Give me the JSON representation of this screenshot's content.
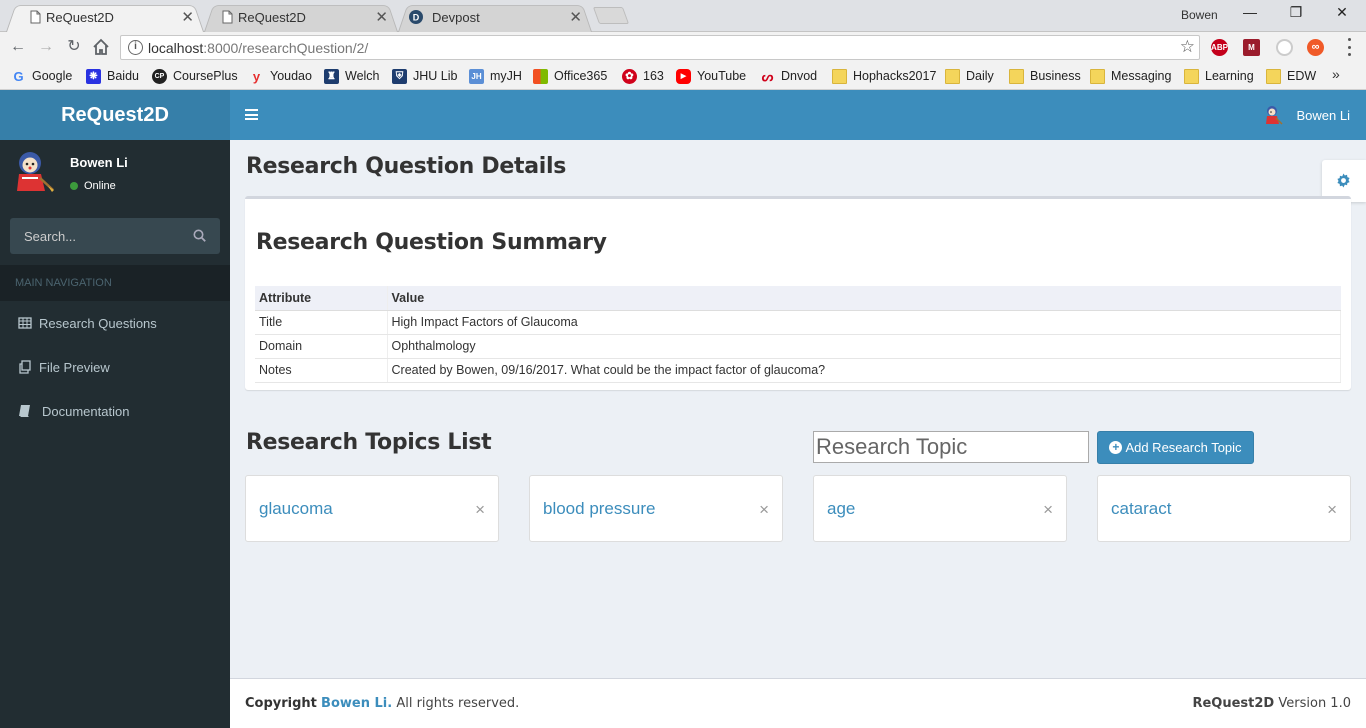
{
  "browser": {
    "tabs": [
      {
        "title": "ReQuest2D",
        "active": true
      },
      {
        "title": "ReQuest2D",
        "active": false
      },
      {
        "title": "Devpost",
        "active": false
      }
    ],
    "profile_name": "Bowen",
    "url_host": "localhost",
    "url_path": ":8000/researchQuestion/2/",
    "bookmarks": [
      {
        "label": "Google",
        "icon": "google-icon",
        "color": "#4285f4"
      },
      {
        "label": "Baidu",
        "icon": "baidu-icon",
        "color": "#2932e1"
      },
      {
        "label": "CoursePlus",
        "icon": "courseplus-icon",
        "color": "#222222"
      },
      {
        "label": "Youdao",
        "icon": "youdao-icon",
        "color": "#e62e2e"
      },
      {
        "label": "Welch",
        "icon": "welch-icon",
        "color": "#1d3c6e"
      },
      {
        "label": "JHU Lib",
        "icon": "jhu-icon",
        "color": "#1d3c6e"
      },
      {
        "label": "myJH",
        "icon": "myjh-icon",
        "color": "#5b8fd6"
      },
      {
        "label": "Office365",
        "icon": "office-icon",
        "color": "#eb3c00"
      },
      {
        "label": "163",
        "icon": "netease-icon",
        "color": "#d0021b"
      },
      {
        "label": "YouTube",
        "icon": "youtube-icon",
        "color": "#ff0000"
      },
      {
        "label": "Dnvod",
        "icon": "dnvod-icon",
        "color": "#d0021b"
      },
      {
        "label": "Hophacks2017",
        "icon": "folder-icon",
        "color": "#f4d55b"
      },
      {
        "label": "Daily",
        "icon": "folder-icon",
        "color": "#f4d55b"
      },
      {
        "label": "Business",
        "icon": "folder-icon",
        "color": "#f4d55b"
      },
      {
        "label": "Messaging",
        "icon": "folder-icon",
        "color": "#f4d55b"
      },
      {
        "label": "Learning",
        "icon": "folder-icon",
        "color": "#f4d55b"
      },
      {
        "label": "EDW",
        "icon": "folder-icon",
        "color": "#f4d55b"
      }
    ],
    "more_bookmarks": "»",
    "extensions": [
      {
        "label": "ABP",
        "color": "#c4001b"
      },
      {
        "label": "M",
        "color": "#9b1c2c"
      },
      {
        "label": "",
        "color": "#cccccc"
      },
      {
        "label": "∞",
        "color": "#f05a28"
      }
    ]
  },
  "app": {
    "logo": "ReQuest2D",
    "brand_color": "#3c8dbc",
    "user": {
      "name": "Bowen Li",
      "status": "Online"
    },
    "search_placeholder": "Search...",
    "nav_header": "MAIN NAVIGATION",
    "nav_items": [
      {
        "label": "Research Questions",
        "icon": "table-icon"
      },
      {
        "label": "File Preview",
        "icon": "files-icon"
      },
      {
        "label": "Documentation",
        "icon": "book-icon"
      }
    ]
  },
  "content": {
    "page_title": "Research Question Details",
    "summary": {
      "title": "Research Question Summary",
      "columns": [
        "Attribute",
        "Value"
      ],
      "rows": [
        [
          "Title",
          "High Impact Factors of Glaucoma"
        ],
        [
          "Domain",
          "Ophthalmology"
        ],
        [
          "Notes",
          "Created by Bowen, 09/16/2017. What could be the impact factor of glaucoma?"
        ]
      ]
    },
    "topics": {
      "title": "Research Topics List",
      "input_placeholder": "Research Topic",
      "add_button": "Add Research Topic",
      "items": [
        "glaucoma",
        "blood pressure",
        "age",
        "cataract"
      ],
      "close_symbol": "×"
    }
  },
  "footer": {
    "copyright_prefix": "Copyright",
    "author": "Bowen Li.",
    "rights": "All rights reserved.",
    "app_name": "ReQuest2D",
    "version": "Version 1.0"
  }
}
